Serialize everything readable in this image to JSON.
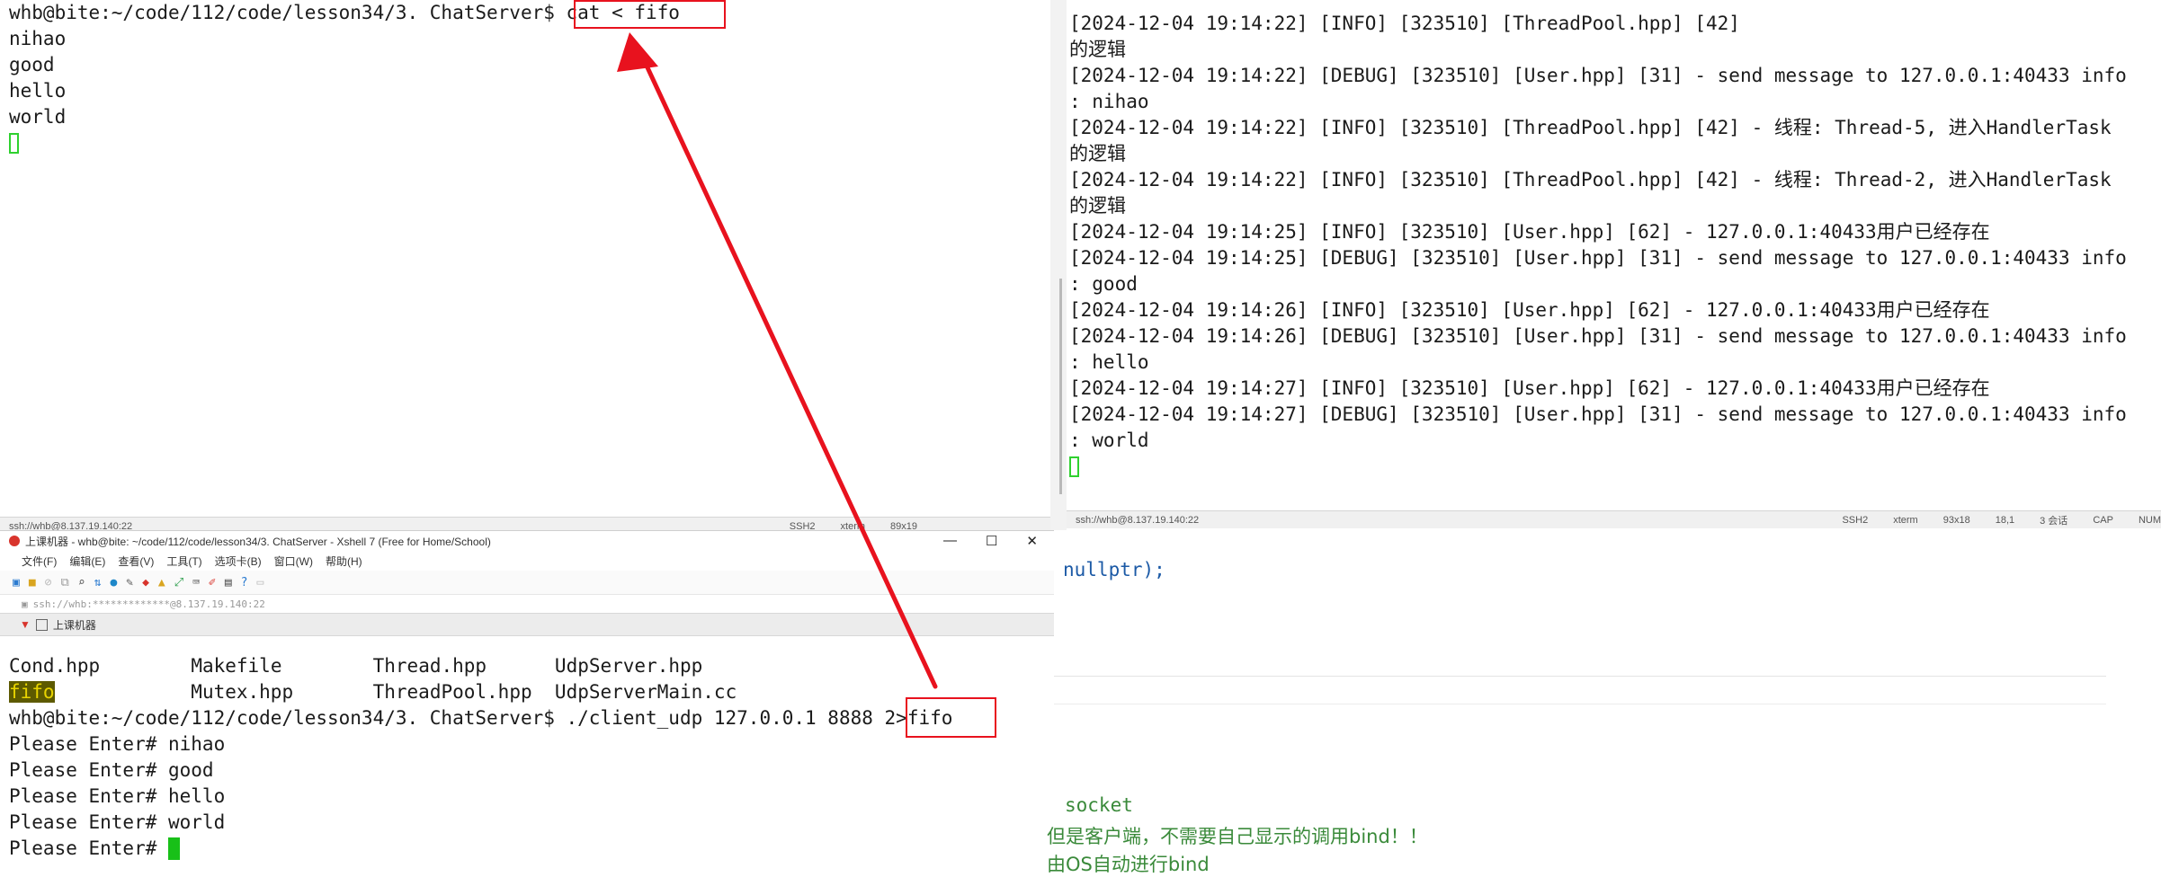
{
  "top_left_terminal": {
    "prompt": "whb@bite:~/code/112/code/lesson34/3. ChatServer$ ",
    "command": "cat < fifo",
    "output": [
      "nihao",
      "good",
      "hello",
      "world"
    ]
  },
  "top_right_terminal": {
    "lines": [
      "[2024-12-04 19:14:22] [INFO] [323510] [ThreadPool.hpp] [42]",
      "的逻辑",
      "[2024-12-04 19:14:22] [DEBUG] [323510] [User.hpp] [31] - send message to 127.0.0.1:40433 info",
      ": nihao",
      "[2024-12-04 19:14:22] [INFO] [323510] [ThreadPool.hpp] [42] - 线程: Thread-5, 进入HandlerTask",
      "的逻辑",
      "[2024-12-04 19:14:22] [INFO] [323510] [ThreadPool.hpp] [42] - 线程: Thread-2, 进入HandlerTask",
      "的逻辑",
      "[2024-12-04 19:14:25] [INFO] [323510] [User.hpp] [62] - 127.0.0.1:40433用户已经存在",
      "[2024-12-04 19:14:25] [DEBUG] [323510] [User.hpp] [31] - send message to 127.0.0.1:40433 info",
      ": good",
      "[2024-12-04 19:14:26] [INFO] [323510] [User.hpp] [62] - 127.0.0.1:40433用户已经存在",
      "[2024-12-04 19:14:26] [DEBUG] [323510] [User.hpp] [31] - send message to 127.0.0.1:40433 info",
      ": hello",
      "[2024-12-04 19:14:27] [INFO] [323510] [User.hpp] [62] - 127.0.0.1:40433用户已经存在",
      "[2024-12-04 19:14:27] [DEBUG] [323510] [User.hpp] [31] - send message to 127.0.0.1:40433 info",
      ": world"
    ]
  },
  "status_left": {
    "ssh": "ssh://whb@8.137.19.140:22",
    "proto": "SSH2",
    "term": "xterm",
    "size": "89x19"
  },
  "status_right": {
    "ssh": "ssh://whb@8.137.19.140:22",
    "proto": "SSH2",
    "term": "xterm",
    "size": "93x18",
    "pos": "18,1",
    "sessions": "3 会话",
    "cap": "CAP",
    "num": "NUM"
  },
  "xshell": {
    "title": "上课机器 - whb@bite: ~/code/112/code/lesson34/3. ChatServer - Xshell 7 (Free for Home/School)",
    "menu": [
      "文件(F)",
      "编辑(E)",
      "查看(V)",
      "工具(T)",
      "选项卡(B)",
      "窗口(W)",
      "帮助(H)"
    ],
    "address": "ssh://whb:*************@8.137.19.140:22",
    "session_tab": "上课机器",
    "win_min": "—",
    "win_max": "☐",
    "win_close": "✕"
  },
  "bottom_left_terminal": {
    "files_row1": [
      "Cond.hpp",
      "Makefile",
      "Thread.hpp",
      "UdpServer.hpp"
    ],
    "files_row2": [
      "fifo",
      "Mutex.hpp",
      "ThreadPool.hpp",
      "UdpServerMain.cc"
    ],
    "prompt": "whb@bite:~/code/112/code/lesson34/3. ChatServer$ ",
    "command": "./client_udp 127.0.0.1 8888 ",
    "redirect": "2>fifo",
    "entries": [
      "Please Enter# nihao",
      "Please Enter# good",
      "Please Enter# hello",
      "Please Enter# world"
    ],
    "last_prompt": "Please Enter# "
  },
  "editor": {
    "line1": "nullptr);",
    "word_socket": "socket",
    "comment": "但是客户端，不需要自己显示的调用bind！！",
    "comment2": "由OS自动进行bind"
  },
  "colors": {
    "annotation_red": "#e8121e",
    "cursor_green": "#18c018",
    "code_blue": "#1c5aa6",
    "comment_green": "#3a8a3a"
  }
}
